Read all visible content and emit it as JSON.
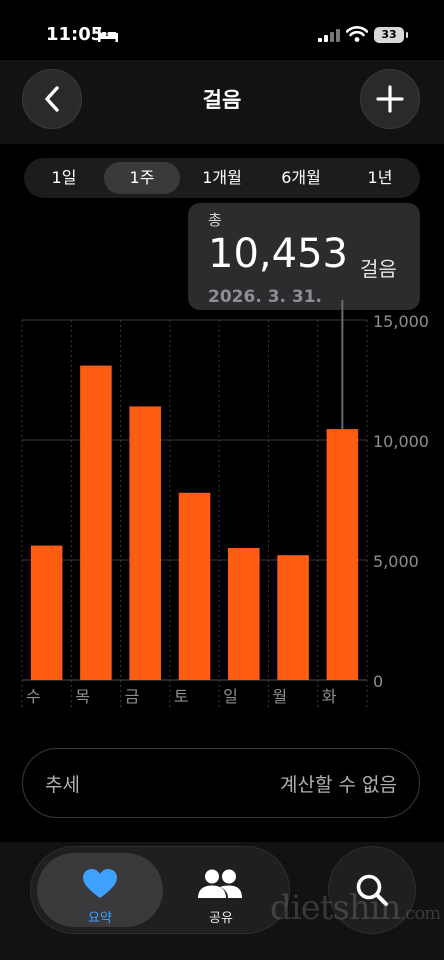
{
  "status": {
    "time": "11:05",
    "battery": "33"
  },
  "header": {
    "title": "걸음"
  },
  "ranges": [
    "1일",
    "1주",
    "1개월",
    "6개월",
    "1년"
  ],
  "selected_range": "1주",
  "tooltip": {
    "label": "총",
    "value": "10,453",
    "unit": "걸음",
    "date": "2026. 3. 31."
  },
  "chart_data": {
    "type": "bar",
    "categories": [
      "수",
      "목",
      "금",
      "토",
      "일",
      "월",
      "화"
    ],
    "values": [
      5600,
      13100,
      11400,
      7800,
      5500,
      5200,
      10453
    ],
    "y_ticks": [
      "15,000",
      "10,000",
      "5,000",
      "0"
    ],
    "ylim": [
      0,
      15000
    ],
    "highlighted_index": 6,
    "bar_color": "#ff5c14",
    "grid": true,
    "xlabel": "",
    "ylabel": ""
  },
  "trend": {
    "label": "추세",
    "value": "계산할 수 없음"
  },
  "tabs": {
    "summary": "요약",
    "share": "공유"
  },
  "watermark": {
    "main": "dietshin",
    "suffix": ".com"
  },
  "colors": {
    "accent": "#3ea0ff",
    "bar": "#ff5c14"
  }
}
